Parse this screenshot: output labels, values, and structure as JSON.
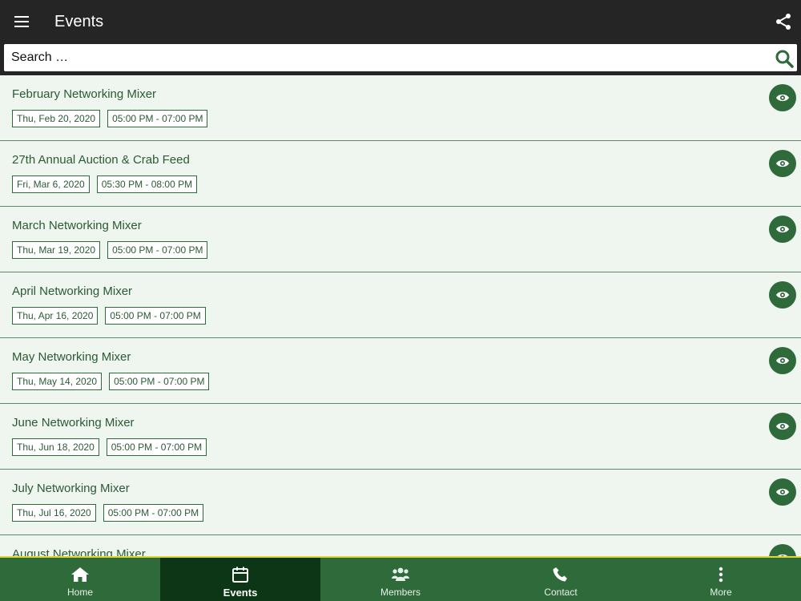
{
  "header": {
    "title": "Events",
    "menu_icon": "hamburger-icon",
    "share_icon": "share-icon"
  },
  "search": {
    "placeholder": "Search …",
    "value": "",
    "icon": "search-icon"
  },
  "events": [
    {
      "title": "February Networking Mixer",
      "date": "Thu, Feb 20, 2020",
      "time": "05:00 PM - 07:00 PM"
    },
    {
      "title": "27th Annual Auction & Crab Feed",
      "date": "Fri, Mar 6, 2020",
      "time": "05:30 PM - 08:00 PM"
    },
    {
      "title": "March Networking Mixer",
      "date": "Thu, Mar 19, 2020",
      "time": "05:00 PM - 07:00 PM"
    },
    {
      "title": "April Networking Mixer",
      "date": "Thu, Apr 16, 2020",
      "time": "05:00 PM - 07:00 PM"
    },
    {
      "title": "May Networking Mixer",
      "date": "Thu, May 14, 2020",
      "time": "05:00 PM - 07:00 PM"
    },
    {
      "title": "June Networking Mixer",
      "date": "Thu, Jun 18, 2020",
      "time": "05:00 PM - 07:00 PM"
    },
    {
      "title": "July Networking Mixer",
      "date": "Thu, Jul 16, 2020",
      "time": "05:00 PM - 07:00 PM"
    },
    {
      "title": "August Networking Mixer",
      "date": "",
      "time": ""
    }
  ],
  "nav": {
    "items": [
      {
        "label": "Home",
        "icon": "home-icon",
        "active": false
      },
      {
        "label": "Events",
        "icon": "calendar-icon",
        "active": true
      },
      {
        "label": "Members",
        "icon": "members-icon",
        "active": false
      },
      {
        "label": "Contact",
        "icon": "phone-icon",
        "active": false
      },
      {
        "label": "More",
        "icon": "more-vertical-icon",
        "active": false
      }
    ]
  },
  "colors": {
    "topbar": "#252525",
    "primary_green": "#2f6a3b",
    "active_green": "#0c3616",
    "row_background": "#eef6ef",
    "accent_yellow": "#e1d731"
  }
}
